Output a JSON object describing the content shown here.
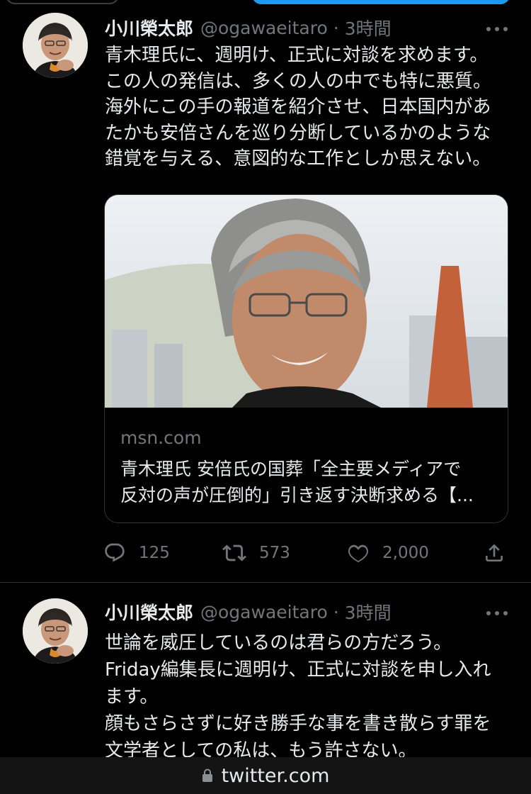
{
  "tweets": [
    {
      "name": "小川榮太郎",
      "handle": "@ogawaeitaro",
      "separator": "·",
      "time": "3時間",
      "body_lines": [
        "青木理氏に、週明け、正式に対談を求めます。",
        "この人の発信は、多くの人の中でも特に悪質。",
        "海外にこの手の報道を紹介させ、日本国内があ",
        "たかも安倍さんを巡り分断しているかのような",
        "錯覚を与える、意図的な工作としか思えない。"
      ],
      "card": {
        "domain": "msn.com",
        "title_lines": [
          "青木理氏 安倍氏の国葬「全主要メディアで",
          "反対の声が圧倒的」引き返す決断求める【..."
        ]
      },
      "stats": {
        "replies": "125",
        "retweets": "573",
        "likes": "2,000"
      }
    },
    {
      "name": "小川榮太郎",
      "handle": "@ogawaeitaro",
      "separator": "·",
      "time": "3時間",
      "body_lines": [
        "世論を威圧しているのは君らの方だろう。",
        "Friday編集長に週明け、正式に対談を申し入れ",
        "ます。",
        "顔もさらさずに好き勝手な事を書き散らす罪を",
        "文学者としての私は、もう許さない。"
      ]
    }
  ],
  "browser": {
    "url": "twitter.com"
  },
  "colors": {
    "background": "#000000",
    "text": "#e7e9ea",
    "muted": "#71767b",
    "border": "#2f3336",
    "accent": "#1d9bf0"
  },
  "icons": [
    "more-icon",
    "reply-icon",
    "retweet-icon",
    "like-icon",
    "share-icon",
    "lock-icon"
  ]
}
